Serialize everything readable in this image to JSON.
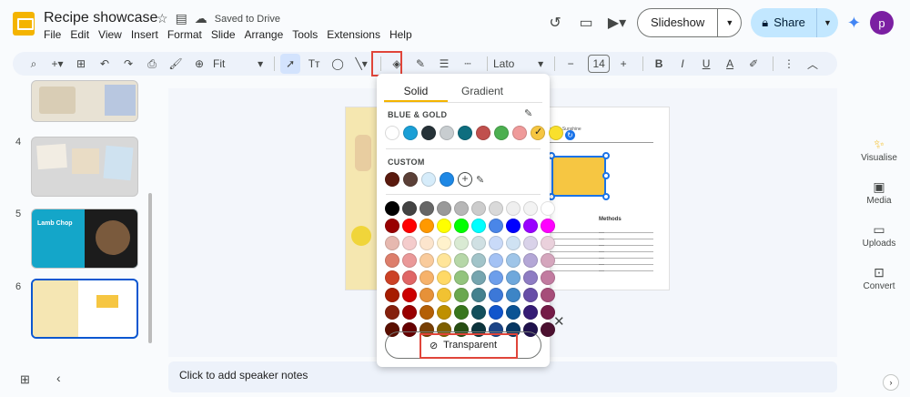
{
  "app": {
    "title": "Recipe showcase",
    "saved_status": "Saved to Drive"
  },
  "menu": [
    "File",
    "Edit",
    "View",
    "Insert",
    "Format",
    "Slide",
    "Arrange",
    "Tools",
    "Extensions",
    "Help"
  ],
  "header": {
    "slideshow_label": "Slideshow",
    "share_label": "Share",
    "avatar_initial": "p"
  },
  "toolbar": {
    "zoom": "Fit",
    "font": "Lato",
    "font_size": "14"
  },
  "slides": [
    {
      "number": "",
      "active": false
    },
    {
      "number": "4",
      "active": false
    },
    {
      "number": "5",
      "active": false,
      "title": "Lamb Chop"
    },
    {
      "number": "6",
      "active": true
    }
  ],
  "slide": {
    "created": "Created by Sunshine",
    "methods_label": "Methods"
  },
  "notes": {
    "placeholder": "Click to add speaker notes"
  },
  "side_panel": [
    {
      "icon": "sparkle-icon",
      "label": "Visualise"
    },
    {
      "icon": "media-icon",
      "label": "Media"
    },
    {
      "icon": "folder-icon",
      "label": "Uploads"
    },
    {
      "icon": "convert-icon",
      "label": "Convert"
    }
  ],
  "color_picker": {
    "tabs": [
      "Solid",
      "Gradient"
    ],
    "active_tab": "Solid",
    "theme_label": "BLUE & GOLD",
    "theme_colors": [
      "#ffffff",
      "#1a9fd6",
      "#263238",
      "#c8cdd0",
      "#0e6e7f",
      "#c0504d",
      "#4caf50",
      "#ef9a9a",
      "#f6c642",
      "#f9e02c"
    ],
    "selected_theme_index": 8,
    "custom_label": "CUSTOM",
    "custom_colors": [
      "#5a1a0e",
      "#5b4037",
      "#d6ecfa",
      "#1e88e5"
    ],
    "palette": [
      [
        "#000000",
        "#434343",
        "#666666",
        "#999999",
        "#b7b7b7",
        "#cccccc",
        "#d9d9d9",
        "#efefef",
        "#f3f3f3",
        "#ffffff"
      ],
      [
        "#980000",
        "#ff0000",
        "#ff9900",
        "#ffff00",
        "#00ff00",
        "#00ffff",
        "#4a86e8",
        "#0000ff",
        "#9900ff",
        "#ff00ff"
      ],
      [
        "#e6b8af",
        "#f4cccc",
        "#fce5cd",
        "#fff2cc",
        "#d9ead3",
        "#d0e0e3",
        "#c9daf8",
        "#cfe2f3",
        "#d9d2e9",
        "#ead1dc"
      ],
      [
        "#dd7e6b",
        "#ea9999",
        "#f9cb9c",
        "#ffe599",
        "#b6d7a8",
        "#a2c4c9",
        "#a4c2f4",
        "#9fc5e8",
        "#b4a7d6",
        "#d5a6bd"
      ],
      [
        "#cc4125",
        "#e06666",
        "#f6b26b",
        "#ffd966",
        "#93c47d",
        "#76a5af",
        "#6d9eeb",
        "#6fa8dc",
        "#8e7cc3",
        "#c27ba0"
      ],
      [
        "#a61c00",
        "#cc0000",
        "#e69138",
        "#f1c232",
        "#6aa84f",
        "#45818e",
        "#3c78d8",
        "#3d85c6",
        "#674ea7",
        "#a64d79"
      ],
      [
        "#85200c",
        "#990000",
        "#b45f06",
        "#bf9000",
        "#38761d",
        "#134f5c",
        "#1155cc",
        "#0b5394",
        "#351c75",
        "#741b47"
      ],
      [
        "#5b0f00",
        "#660000",
        "#783f04",
        "#7f6000",
        "#274e13",
        "#0c343d",
        "#1c4587",
        "#073763",
        "#20124d",
        "#4c1130"
      ]
    ],
    "transparent_label": "Transparent"
  },
  "colors": {
    "accent": "#0b57d0",
    "share_bg": "#c2e7ff",
    "highlight": "#e0453a"
  }
}
